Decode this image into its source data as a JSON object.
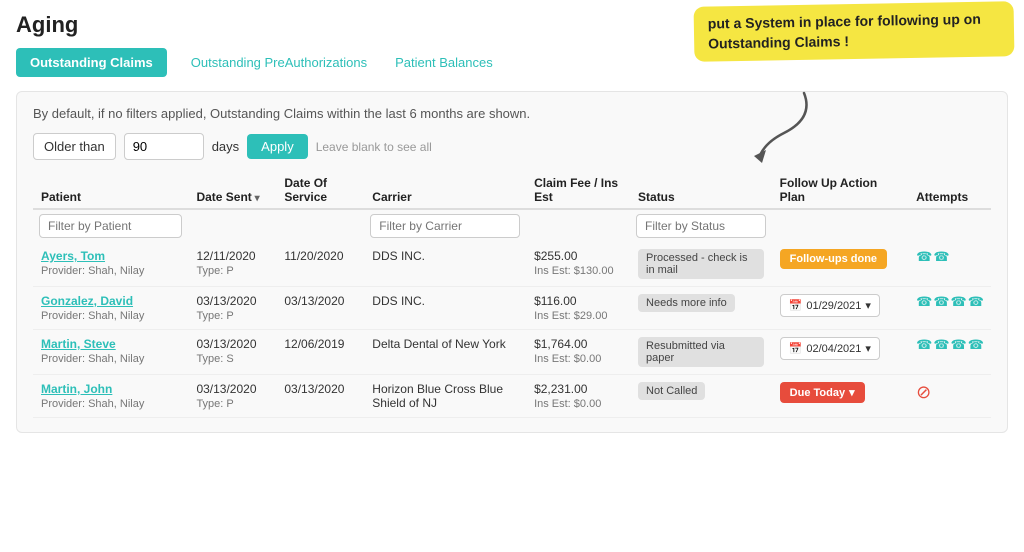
{
  "page": {
    "title": "Aging",
    "annotation": "put a System in place for following up on Outstanding Claims !",
    "description": "By default, if no filters applied, Outstanding Claims within the last 6 months are shown.",
    "filter": {
      "older_than_label": "Older than",
      "days_value": "90",
      "days_label": "days",
      "apply_label": "Apply",
      "leave_blank": "Leave blank to see all"
    }
  },
  "tabs": [
    {
      "id": "outstanding-claims",
      "label": "Outstanding Claims",
      "active": true
    },
    {
      "id": "outstanding-preauths",
      "label": "Outstanding PreAuthorizations",
      "active": false
    },
    {
      "id": "patient-balances",
      "label": "Patient Balances",
      "active": false
    }
  ],
  "table": {
    "columns": [
      {
        "id": "patient",
        "label": "Patient",
        "sortable": false
      },
      {
        "id": "date-sent",
        "label": "Date Sent",
        "sortable": true
      },
      {
        "id": "date-service",
        "label": "Date Of Service",
        "sortable": false
      },
      {
        "id": "carrier",
        "label": "Carrier",
        "sortable": false
      },
      {
        "id": "fee",
        "label": "Claim Fee / Ins Est",
        "sortable": false
      },
      {
        "id": "status",
        "label": "Status",
        "sortable": false
      },
      {
        "id": "followup",
        "label": "Follow Up Action Plan",
        "sortable": false
      },
      {
        "id": "attempts",
        "label": "Attempts",
        "sortable": false
      }
    ],
    "filters": {
      "patient_placeholder": "Filter by Patient",
      "carrier_placeholder": "Filter by Carrier",
      "status_placeholder": "Filter by Status"
    },
    "rows": [
      {
        "patient_name": "Ayers, Tom",
        "provider": "Provider: Shah, Nilay",
        "date_sent": "12/11/2020",
        "date_sent_type": "Type: P",
        "date_service": "11/20/2020",
        "carrier": "DDS INC.",
        "fee": "$255.00",
        "ins_est": "Ins Est: $130.00",
        "status": "Processed - check is in mail",
        "status_type": "processed",
        "followup": "Follow-ups done",
        "followup_type": "done",
        "attempts": "uu",
        "attempts_type": "phone"
      },
      {
        "patient_name": "Gonzalez, David",
        "provider": "Provider: Shah, Nilay",
        "date_sent": "03/13/2020",
        "date_sent_type": "Type: P",
        "date_service": "03/13/2020",
        "carrier": "DDS INC.",
        "fee": "$116.00",
        "ins_est": "Ins Est: $29.00",
        "status": "Needs more info",
        "status_type": "needs-more",
        "followup": "01/29/2021",
        "followup_type": "date",
        "attempts": "uuuu",
        "attempts_type": "phone"
      },
      {
        "patient_name": "Martin, Steve",
        "provider": "Provider: Shah, Nilay",
        "date_sent": "03/13/2020",
        "date_sent_type": "Type: S",
        "date_service": "12/06/2019",
        "carrier": "Delta Dental of New York",
        "fee": "$1,764.00",
        "ins_est": "Ins Est: $0.00",
        "status": "Resubmitted via paper",
        "status_type": "resubmitted",
        "followup": "02/04/2021",
        "followup_type": "date",
        "attempts": "uuuu",
        "attempts_type": "phone"
      },
      {
        "patient_name": "Martin, John",
        "provider": "Provider: Shah, Nilay",
        "date_sent": "03/13/2020",
        "date_sent_type": "Type: P",
        "date_service": "03/13/2020",
        "carrier": "Horizon Blue Cross Blue Shield of NJ",
        "fee": "$2,231.00",
        "ins_est": "Ins Est: $0.00",
        "status": "Not Called",
        "status_type": "not-called",
        "followup": "Due Today",
        "followup_type": "due-today",
        "attempts": "⊘",
        "attempts_type": "none"
      }
    ]
  },
  "colors": {
    "teal": "#2dbfb8",
    "orange": "#f5a623",
    "red": "#e74c3c",
    "yellow_annotation": "#f5e642"
  }
}
